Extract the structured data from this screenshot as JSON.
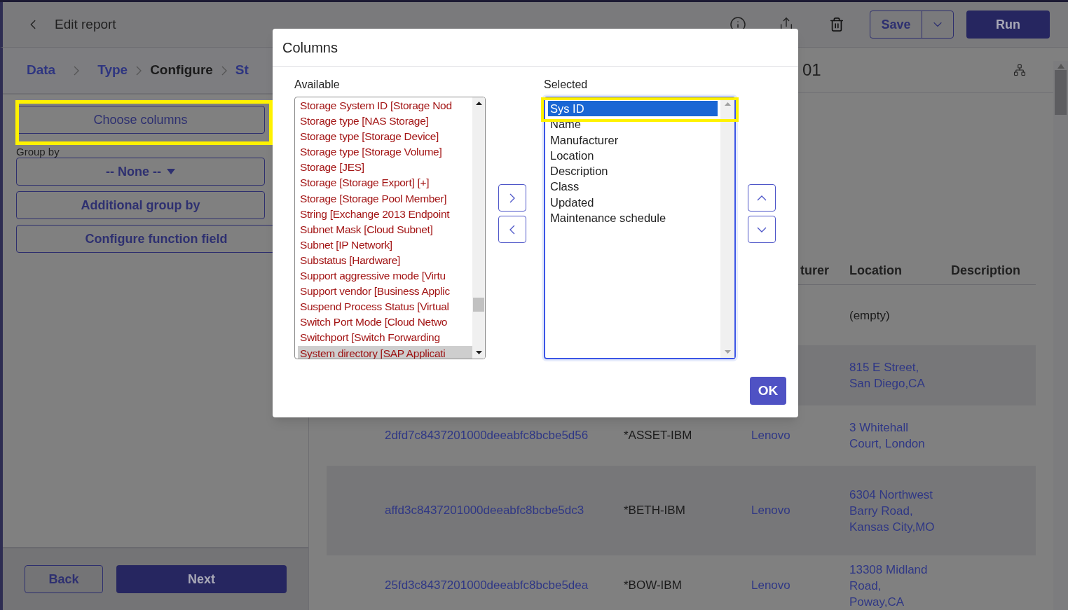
{
  "topbar": {
    "title": "Edit report",
    "save": "Save",
    "run": "Run"
  },
  "steps": [
    {
      "label": "Data",
      "current": false
    },
    {
      "label": "Type",
      "current": false
    },
    {
      "label": "Configure",
      "current": true
    },
    {
      "label": "St",
      "current": false
    }
  ],
  "options": {
    "choose_columns": "Choose columns",
    "group_by_label": "Group by",
    "group_by_value": "-- None --",
    "additional_group_by": "Additional group by",
    "configure_function_field": "Configure function field"
  },
  "footer": {
    "back": "Back",
    "next": "Next"
  },
  "report_title": "01",
  "table": {
    "columns": [
      "turer",
      "Location",
      "Description"
    ],
    "rows": [
      {
        "location": "(empty)"
      },
      {
        "location": "815 E Street, San Diego,CA"
      },
      {
        "sys_id": "2dfd7c8437201000deeabfc8bcbe5d56",
        "name": "*ASSET-IBM",
        "manufacturer": "Lenovo",
        "location": "3 Whitehall Court, London"
      },
      {
        "sys_id": "affd3c8437201000deeabfc8bcbe5dc3",
        "name": "*BETH-IBM",
        "manufacturer": "Lenovo",
        "location": "6304 Northwest Barry Road, Kansas City,MO"
      },
      {
        "sys_id": "25fd3c8437201000deeabfc8bcbe5dea",
        "name": "*BOW-IBM",
        "manufacturer": "Lenovo",
        "location": "13308 Midland Road, Poway,CA"
      }
    ]
  },
  "dialog": {
    "title": "Columns",
    "available_label": "Available",
    "selected_label": "Selected",
    "ok": "OK",
    "available": [
      {
        "text": "Storage System ID [Storage Nod",
        "selected": false
      },
      {
        "text": "Storage type [NAS Storage]",
        "selected": false
      },
      {
        "text": "Storage type [Storage Device]",
        "selected": false
      },
      {
        "text": "Storage type [Storage Volume]",
        "selected": false
      },
      {
        "text": "Storage [JES]",
        "selected": false
      },
      {
        "text": "Storage [Storage Export] [+]",
        "selected": false
      },
      {
        "text": "Storage [Storage Pool Member]",
        "selected": false
      },
      {
        "text": "String [Exchange 2013 Endpoint",
        "selected": false
      },
      {
        "text": "Subnet Mask [Cloud Subnet]",
        "selected": false
      },
      {
        "text": "Subnet [IP Network]",
        "selected": false
      },
      {
        "text": "Substatus [Hardware]",
        "selected": false
      },
      {
        "text": "Support aggressive mode [Virtu",
        "selected": false
      },
      {
        "text": "Support vendor [Business Applic",
        "selected": false
      },
      {
        "text": "Suspend Process Status [Virtual",
        "selected": false
      },
      {
        "text": "Switch Port Mode [Cloud Netwo",
        "selected": false
      },
      {
        "text": "Switchport [Switch Forwarding",
        "selected": false
      },
      {
        "text": "System directory [SAP Applicati",
        "selected": true
      }
    ],
    "selected": [
      {
        "text": "Sys ID",
        "selected": true
      },
      {
        "text": "Name",
        "selected": false
      },
      {
        "text": "Manufacturer",
        "selected": false
      },
      {
        "text": "Location",
        "selected": false
      },
      {
        "text": "Description",
        "selected": false
      },
      {
        "text": "Class",
        "selected": false
      },
      {
        "text": "Updated",
        "selected": false
      },
      {
        "text": "Maintenance schedule",
        "selected": false
      }
    ]
  }
}
